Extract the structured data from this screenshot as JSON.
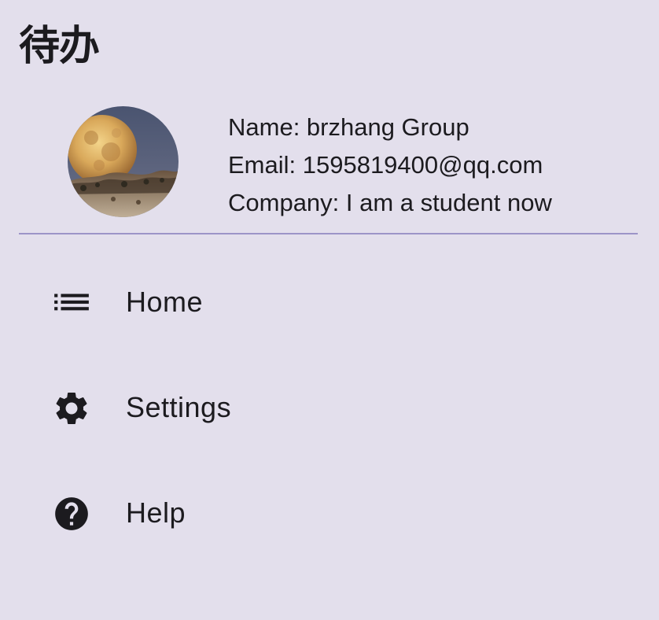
{
  "drawer": {
    "title": "待办"
  },
  "profile": {
    "name_line": "Name: brzhang Group",
    "email_line": "Email: 1595819400@qq.com",
    "company_line": "Company: I am a student now",
    "avatar_icon": "moon-photo-avatar"
  },
  "menu": {
    "items": [
      {
        "label": "Home",
        "icon": "list-icon"
      },
      {
        "label": "Settings",
        "icon": "gear-icon"
      },
      {
        "label": "Help",
        "icon": "help-icon"
      }
    ]
  },
  "colors": {
    "background": "#e3dfec",
    "divider": "#9c94c8",
    "text": "#1c1b1f"
  }
}
